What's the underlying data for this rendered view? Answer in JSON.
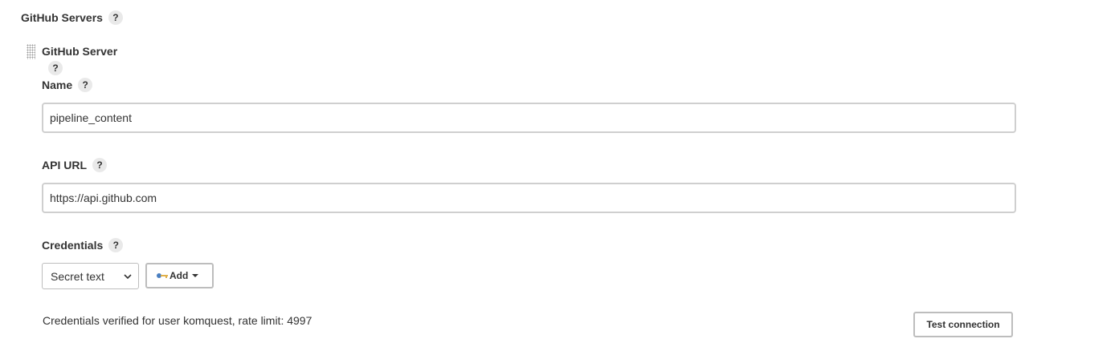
{
  "section": {
    "title": "GitHub Servers",
    "help_label": "?"
  },
  "server": {
    "title": "GitHub Server",
    "help_label": "?",
    "fields": {
      "name": {
        "label": "Name",
        "help_label": "?",
        "value": "pipeline_content"
      },
      "api_url": {
        "label": "API URL",
        "help_label": "?",
        "value": "https://api.github.com"
      },
      "credentials": {
        "label": "Credentials",
        "help_label": "?",
        "selected": "Secret text",
        "add_label": "Add"
      }
    },
    "status": "Credentials verified for user komquest, rate limit: 4997",
    "test_button_label": "Test connection"
  },
  "icons": {
    "help": "question-mark-icon",
    "drag": "drag-handle-icon",
    "add": "key-icon",
    "add_caret": "caret-down-icon",
    "select_chevron": "chevron-down-icon"
  },
  "colors": {
    "key_blue": "#4a7fc1",
    "key_gold": "#e0b04a",
    "input_border": "#cfcfcf",
    "help_bg": "#e9e9e9"
  }
}
